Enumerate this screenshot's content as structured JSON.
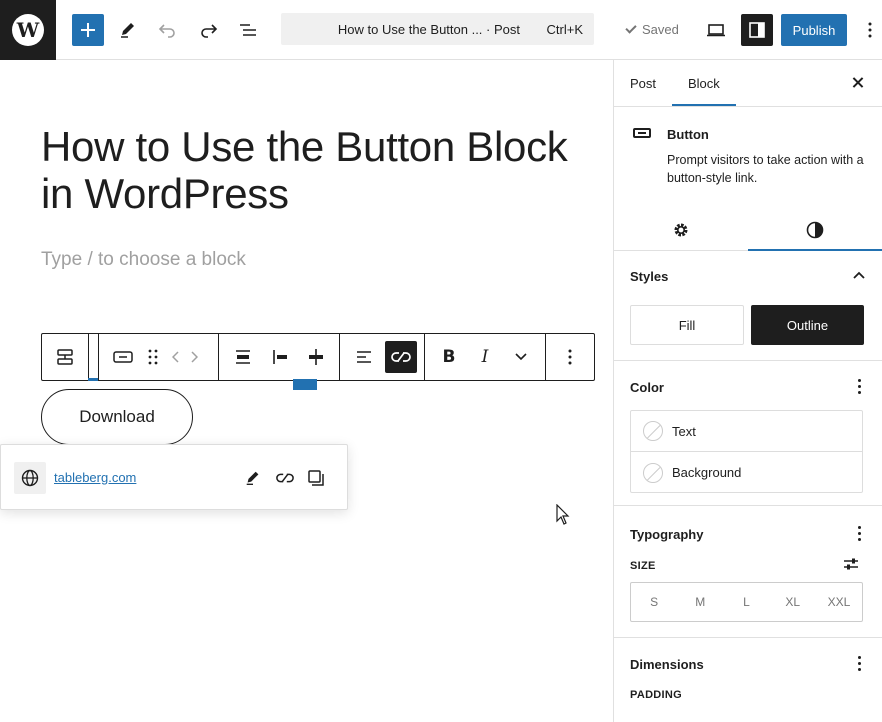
{
  "topbar": {
    "logo": "W",
    "add_block_icon": "plus-icon",
    "tools_icon": "pencil-icon",
    "undo_icon": "undo-icon",
    "redo_icon": "redo-icon",
    "document_overview_icon": "list-view-icon",
    "document_title": "How to Use the Button ... · Post",
    "shortcut": "Ctrl+K",
    "saved_label": "Saved",
    "publish_label": "Publish",
    "accent_color": "#2271b1"
  },
  "editor": {
    "post_title": "How to Use the Button Block in WordPress",
    "block_placeholder": "Type / to choose a block",
    "button_text": "Download",
    "link_url": "tableberg.com"
  },
  "sidebar": {
    "tabs": [
      {
        "label": "Post",
        "active": false
      },
      {
        "label": "Block",
        "active": true
      }
    ],
    "block_card": {
      "title": "Button",
      "description": "Prompt visitors to take action with a button-style link."
    },
    "styles": {
      "title": "Styles",
      "options": [
        {
          "label": "Fill",
          "selected": false
        },
        {
          "label": "Outline",
          "selected": true
        }
      ]
    },
    "color": {
      "title": "Color",
      "items": [
        "Text",
        "Background"
      ]
    },
    "typography": {
      "title": "Typography",
      "size_label": "SIZE",
      "sizes": [
        "S",
        "M",
        "L",
        "XL",
        "XXL"
      ]
    },
    "dimensions": {
      "title": "Dimensions",
      "padding_label": "PADDING"
    }
  }
}
